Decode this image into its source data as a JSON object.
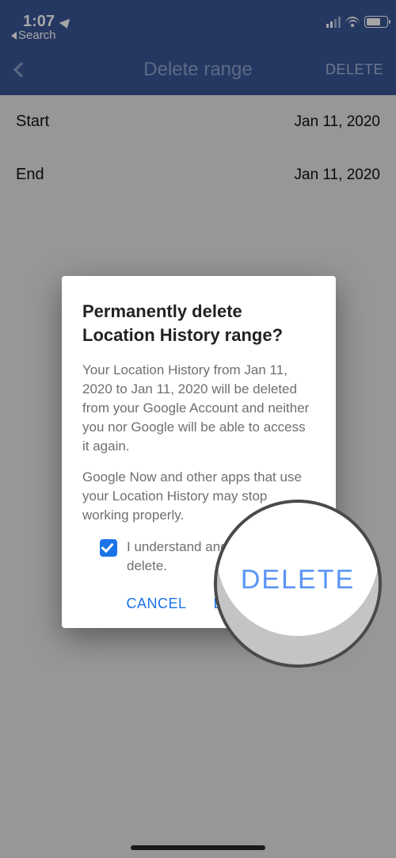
{
  "status": {
    "time": "1:07",
    "back_app": "Search"
  },
  "nav": {
    "title": "Delete range",
    "action": "DELETE"
  },
  "rows": {
    "start_label": "Start",
    "start_value": "Jan 11, 2020",
    "end_label": "End",
    "end_value": "Jan 11, 2020"
  },
  "dialog": {
    "title": "Permanently delete Location History range?",
    "body1": "Your Location History from Jan 11, 2020 to Jan 11, 2020 will be deleted from your Google Account and neither you nor Google will be able to access it again.",
    "body2": "Google Now and other apps that use your Location History may stop working properly.",
    "consent": "I understand and want to delete.",
    "cancel": "CANCEL",
    "confirm": "DELETE"
  },
  "magnifier": {
    "text": "DELETE"
  }
}
